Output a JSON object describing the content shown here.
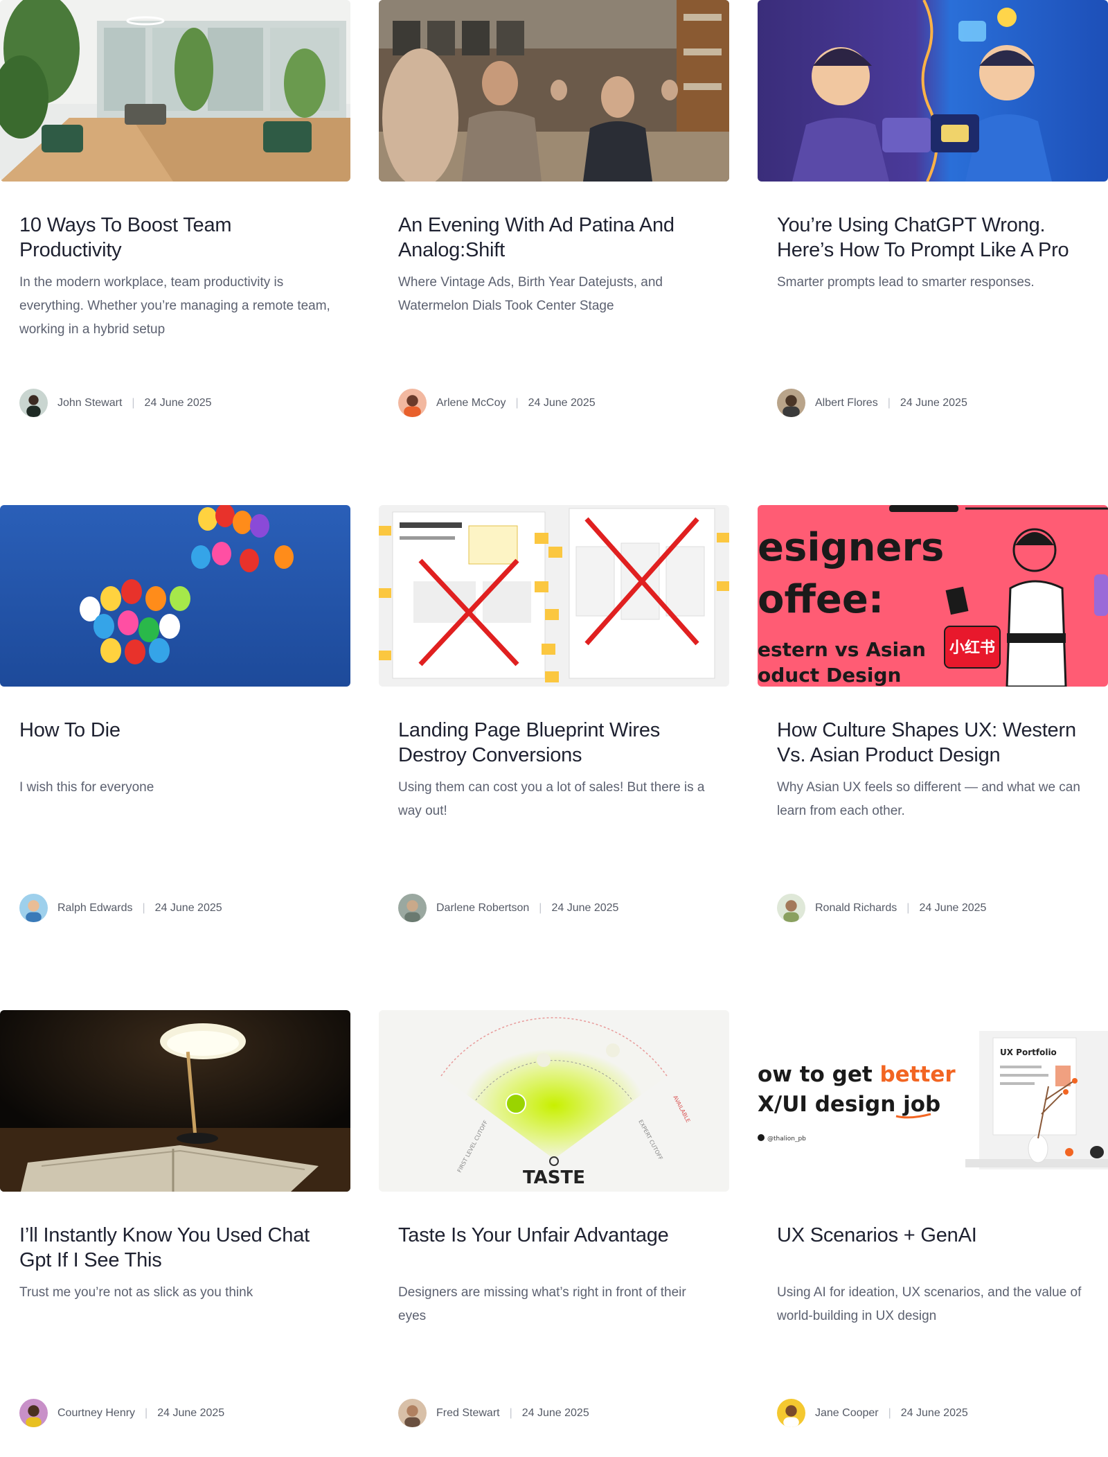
{
  "posts": [
    {
      "title": "10 Ways To Boost Team Productivity",
      "excerpt": "In the modern workplace, team productivity is everything. Whether you’re managing a remote team, working in a hybrid setup",
      "author": "John Stewart",
      "date": "24 June 2025"
    },
    {
      "title": "An Evening With Ad Patina And Analog:Shift",
      "excerpt": "Where Vintage Ads, Birth Year Datejusts, and Watermelon Dials Took Center Stage",
      "author": "Arlene McCoy",
      "date": "24 June 2025"
    },
    {
      "title": "You’re Using ChatGPT Wrong. Here’s How To Prompt Like A Pro",
      "excerpt": "Smarter prompts lead to smarter responses.",
      "author": "Albert Flores",
      "date": "24 June 2025"
    },
    {
      "title": "How To Die",
      "excerpt": "I wish this for everyone",
      "author": "Ralph Edwards",
      "date": "24 June 2025"
    },
    {
      "title": "Landing Page Blueprint Wires Destroy Conversions",
      "excerpt": "Using them can cost you a lot of sales! But there is a way out!",
      "author": "Darlene Robertson",
      "date": "24 June 2025"
    },
    {
      "title": "How Culture Shapes UX: Western Vs. Asian Product Design",
      "excerpt": "Why Asian UX feels so different — and what we can learn from each other.",
      "author": "Ronald Richards",
      "date": "24 June 2025"
    },
    {
      "title": "I’ll Instantly Know You Used Chat Gpt If I See This",
      "excerpt": "Trust me you’re not as slick as you think",
      "author": "Courtney Henry",
      "date": "24 June 2025"
    },
    {
      "title": "Taste Is Your Unfair Advantage",
      "excerpt": "Designers are missing what’s right in front of their eyes",
      "author": "Fred Stewart",
      "date": "24 June 2025"
    },
    {
      "title": "UX Scenarios + GenAI",
      "excerpt": "Using AI for ideation, UX scenarios, and the value of world-building in UX design",
      "author": "Jane Cooper",
      "date": "24 June 2025"
    }
  ],
  "images": {
    "designers_coffee": {
      "line1": "esigners",
      "line2": "offee:",
      "line3": "estern vs Asian",
      "line4": "oduct Design",
      "badge": "小红书"
    },
    "taste": {
      "label": "TASTE",
      "left_axis": "FIRST LEVEL CUTOFF",
      "right_axis": "EXPERT CUTOFF",
      "far_right": "AVAILABLE"
    },
    "portfolio": {
      "line1a": "ow to get ",
      "line1b": "better",
      "line2a": "X/UI design ",
      "line2b": "job",
      "handle": "@thalion_pb",
      "book_title": "UX Portfolio"
    }
  },
  "colors": {
    "title": "#1e2130",
    "excerpt": "#5c6170",
    "meta": "#555a66",
    "coffee_bg": "#ff5c74",
    "accent_orange": "#f26522"
  }
}
